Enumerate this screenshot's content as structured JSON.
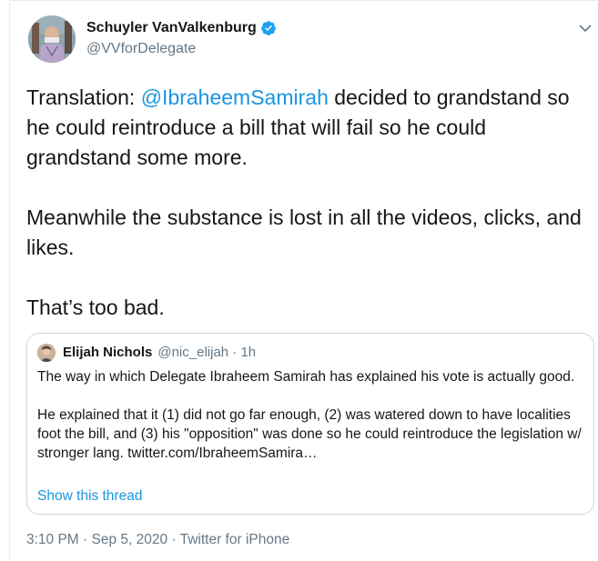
{
  "author": {
    "name": "Schuyler VanValkenburg",
    "handle": "@VVforDelegate",
    "verified": true,
    "avatar_icon": "profile-photo"
  },
  "tweet": {
    "prefix": "Translation: ",
    "mention": "@IbraheemSamirah",
    "line1_rest": " decided to grandstand so he could reintroduce a bill that will fail so he could grandstand some more.",
    "paragraph2": "Meanwhile the substance is lost in all the videos, clicks, and likes.",
    "paragraph3": "That’s too bad."
  },
  "quoted": {
    "name": "Elijah Nichols",
    "meta": "@nic_elijah · 1h",
    "body": "The way in which Delegate Ibraheem Samirah has explained his vote is actually good.\n\nHe explained that it (1) did not go far enough, (2) was watered down to have localities foot the bill, and (3) his \"opposition\" was done so he could reintroduce the legislation w/ stronger lang. twitter.com/IbraheemSamira…",
    "show_thread": "Show this thread"
  },
  "footer": {
    "timestamp": "3:10 PM · Sep 5, 2020 · Twitter for iPhone"
  },
  "colors": {
    "link": "#1b95e0",
    "secondary": "#657786",
    "border": "#ccd6dd"
  }
}
